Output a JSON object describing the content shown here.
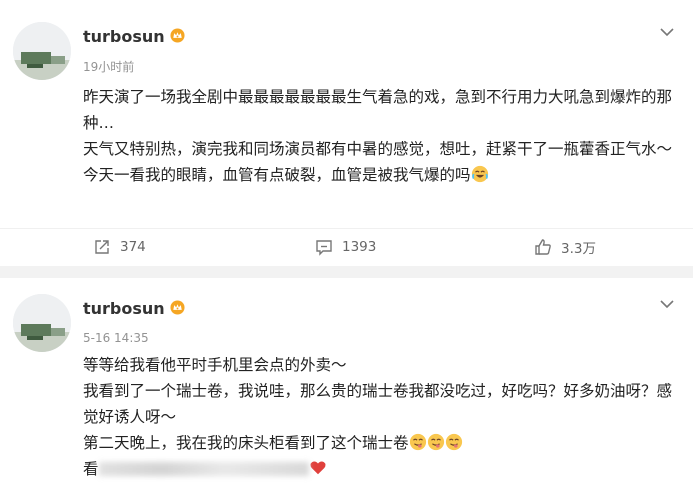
{
  "posts": [
    {
      "username": "turbosun",
      "time": "19小时前",
      "lines": [
        "昨天演了一场我全剧中最最最最最最最生气着急的戏，急到不行用力大吼急到爆炸的那种…",
        "天气又特别热，演完我和同场演员都有中暑的感觉，想吐，赶紧干了一瓶藿香正气水～",
        "今天一看我的眼睛，血管有点破裂，血管是被我气爆的吗"
      ],
      "stats": {
        "repost": "374",
        "comment": "1393",
        "like": "3.3万"
      }
    },
    {
      "username": "turbosun",
      "time": "5-16 14:35",
      "lines": [
        "等等给我看他平时手机里会点的外卖～",
        "我看到了一个瑞士卷，我说哇，那么贵的瑞士卷我都没吃过，好吃吗？好多奶油呀？感觉好诱人呀～",
        "第二天晚上，我在我的床头柜看到了这个瑞士卷",
        "看"
      ]
    }
  ],
  "icons": {
    "badge": "vip-crown-icon",
    "menu": "chevron-down-icon",
    "repost": "repost-icon",
    "comment": "comment-icon",
    "like": "thumbs-up-icon",
    "emoji_cry_laugh": "laugh-cry-emoji",
    "emoji_tongue": "yummy-emoji",
    "emoji_heart": "heart-emoji"
  },
  "colors": {
    "background": "#f2f2f2",
    "card": "#ffffff",
    "text": "#222222",
    "meta": "#939393",
    "badge": "#f5a623"
  }
}
